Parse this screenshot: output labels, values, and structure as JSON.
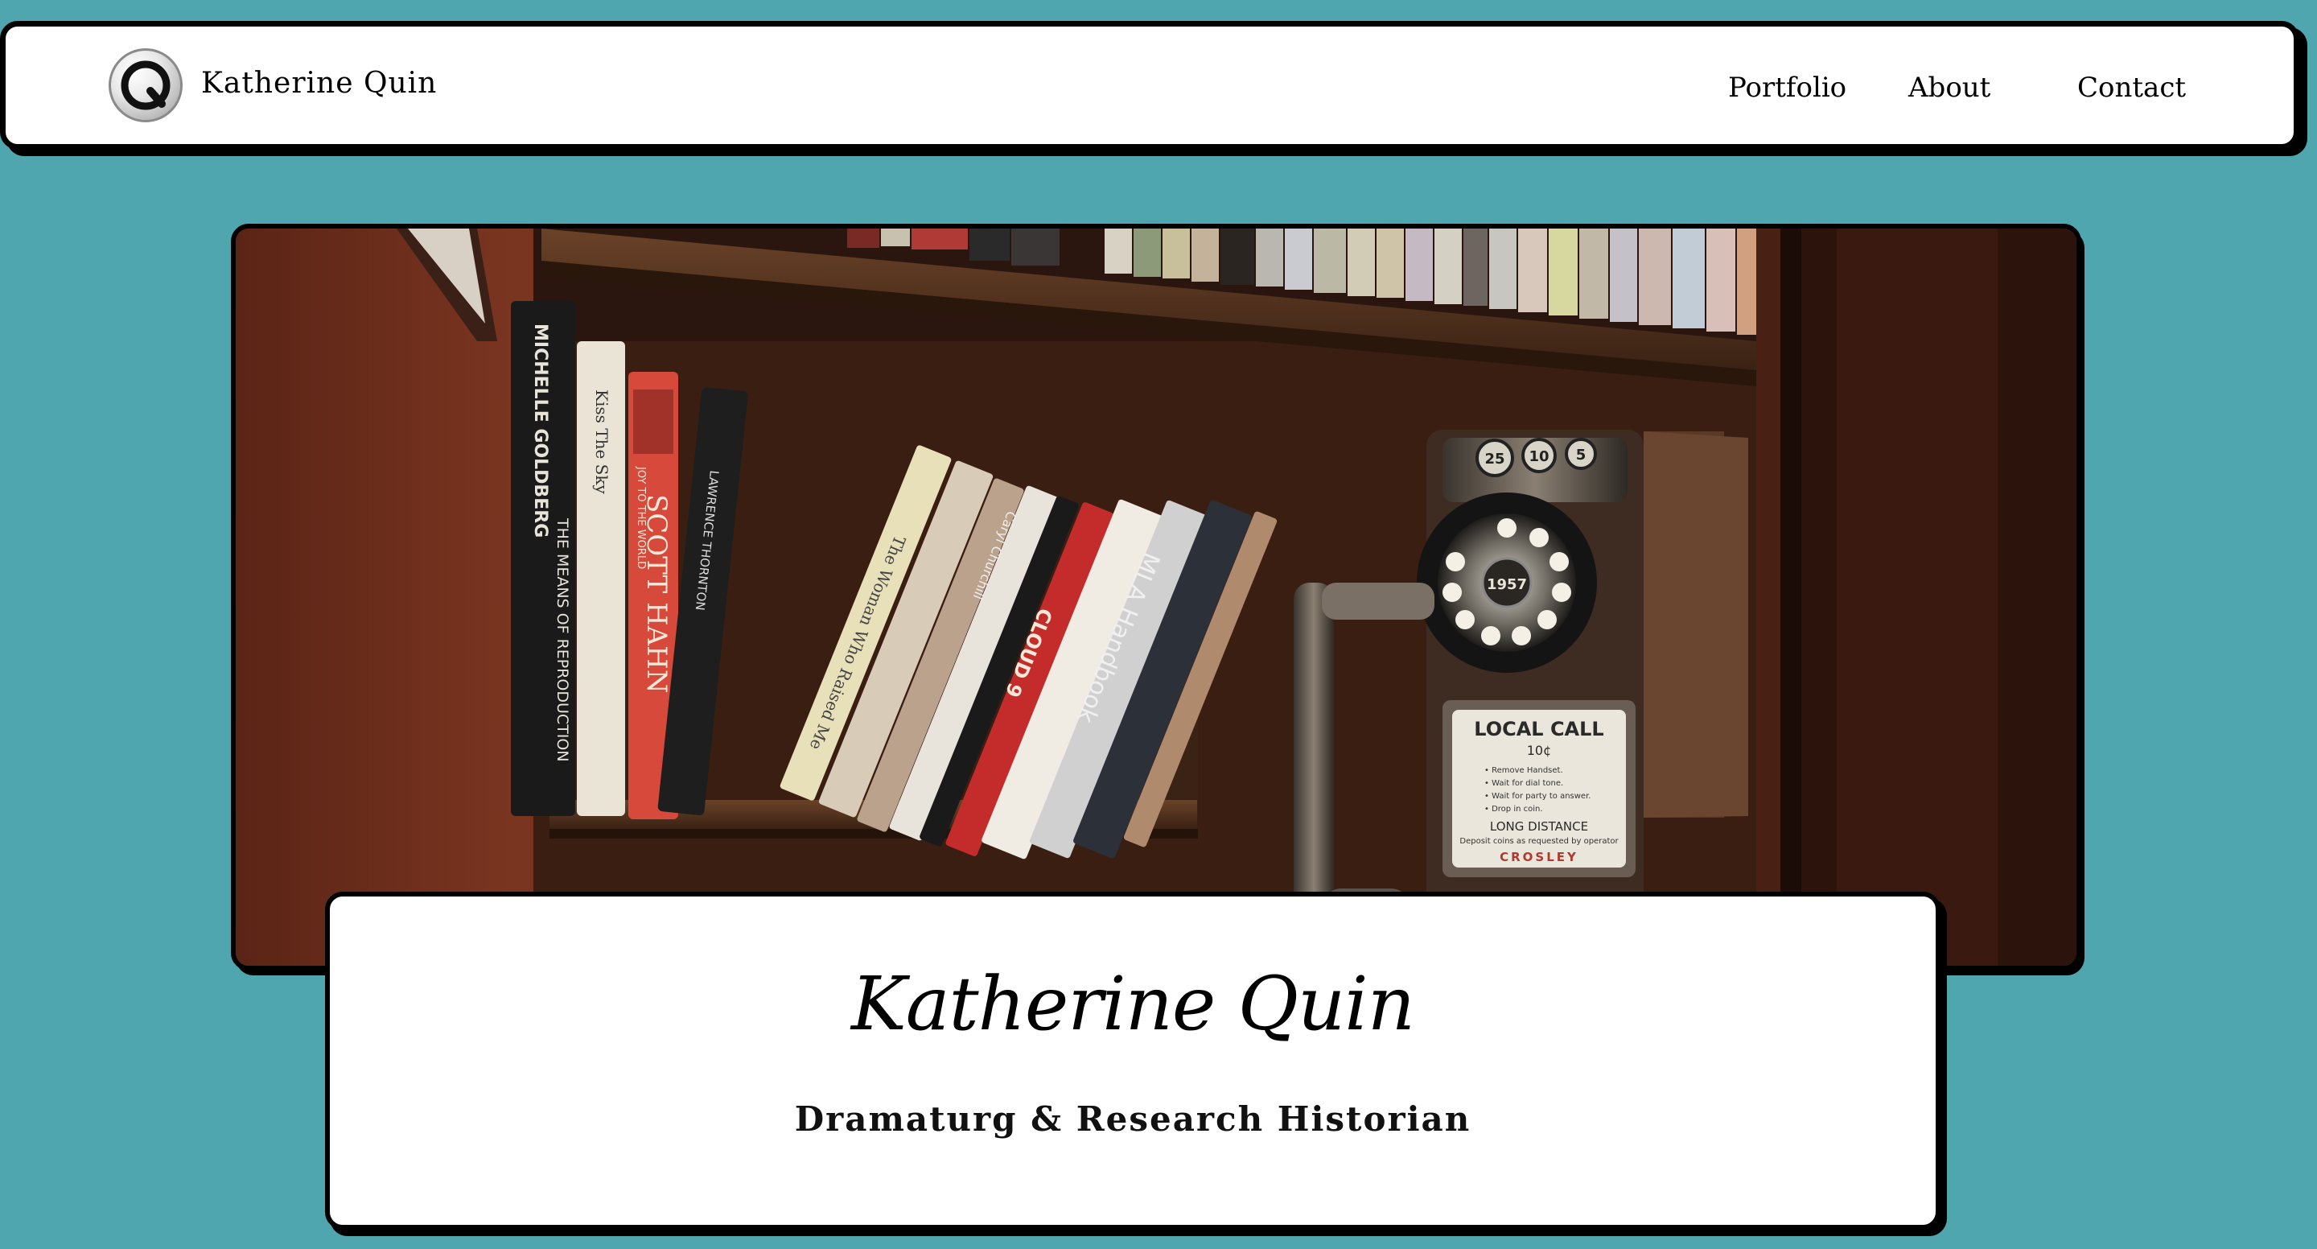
{
  "header": {
    "logo_letter": "Q",
    "site_name": "Katherine Quin",
    "nav": {
      "portfolio": "Portfolio",
      "about": "About",
      "contact": "Contact"
    }
  },
  "hero": {
    "books": {
      "b1": "MICHELLE GOLDBERG",
      "b1b": "THE MEANS OF REPRODUCTION",
      "b2": "Kiss The Sky",
      "b3": "SCOTT HAHN",
      "b3b": "JOY TO THE WORLD",
      "b4": "LAWRENCE THORNTON",
      "b5": "CLOUD 9",
      "b6": "Caryl Churchill",
      "b7": "MLA Handbook",
      "b8": "The Woman Who Raised Me"
    },
    "phone": {
      "coin_25": "25",
      "coin_10": "10",
      "coin_5": "5",
      "dial_center": "1957",
      "plate_title": "LOCAL CALL",
      "plate_price": "10¢",
      "plate_line1": "• Remove Handset.",
      "plate_line2": "• Wait for dial tone.",
      "plate_line3": "• Wait for party to answer.",
      "plate_line4": "• Drop in coin.",
      "plate_long": "LONG DISTANCE",
      "plate_note": "Deposit coins as requested by operator",
      "plate_brand": "CROSLEY"
    }
  },
  "card": {
    "title": "Katherine Quin",
    "subtitle": "Dramaturg & Research Historian"
  },
  "colors": {
    "background": "#4fa6ae",
    "wall": "#6b2e1c",
    "shelf": "#4a2c1a"
  }
}
